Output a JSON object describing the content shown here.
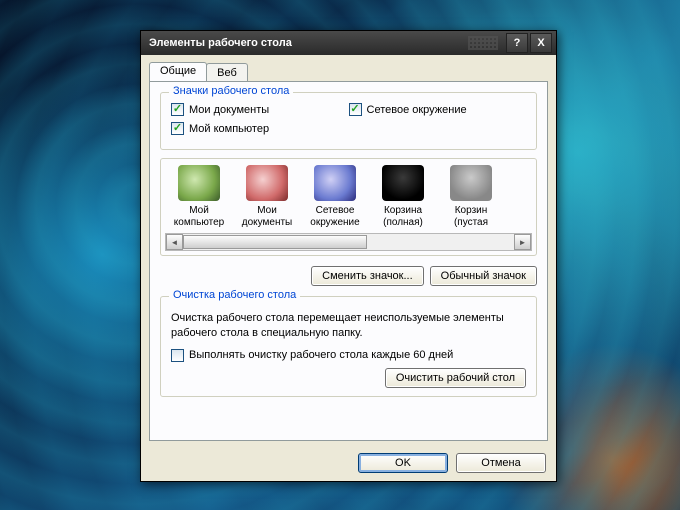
{
  "window": {
    "title": "Элементы рабочего стола",
    "help": "?",
    "close": "X"
  },
  "tabs": {
    "general": "Общие",
    "web": "Веб"
  },
  "group_icons": {
    "title": "Значки рабочего стола",
    "my_docs": "Мои документы",
    "my_comp": "Мой компьютер",
    "network": "Сетевое окружение"
  },
  "icon_items": [
    {
      "label1": "Мой",
      "label2": "компьютер"
    },
    {
      "label1": "Мои",
      "label2": "документы"
    },
    {
      "label1": "Сетевое",
      "label2": "окружение"
    },
    {
      "label1": "Корзина",
      "label2": "(полная)"
    },
    {
      "label1": "Корзин",
      "label2": "(пустая"
    }
  ],
  "buttons": {
    "change_icon": "Сменить значок...",
    "default_icon": "Обычный значок",
    "clean_desktop": "Очистить рабочий стол",
    "ok": "OK",
    "cancel": "Отмена"
  },
  "group_clean": {
    "title": "Очистка рабочего стола",
    "desc": "Очистка рабочего стола перемещает неиспользуемые элементы рабочего стола в специальную папку.",
    "check": "Выполнять очистку рабочего стола каждые 60 дней"
  }
}
